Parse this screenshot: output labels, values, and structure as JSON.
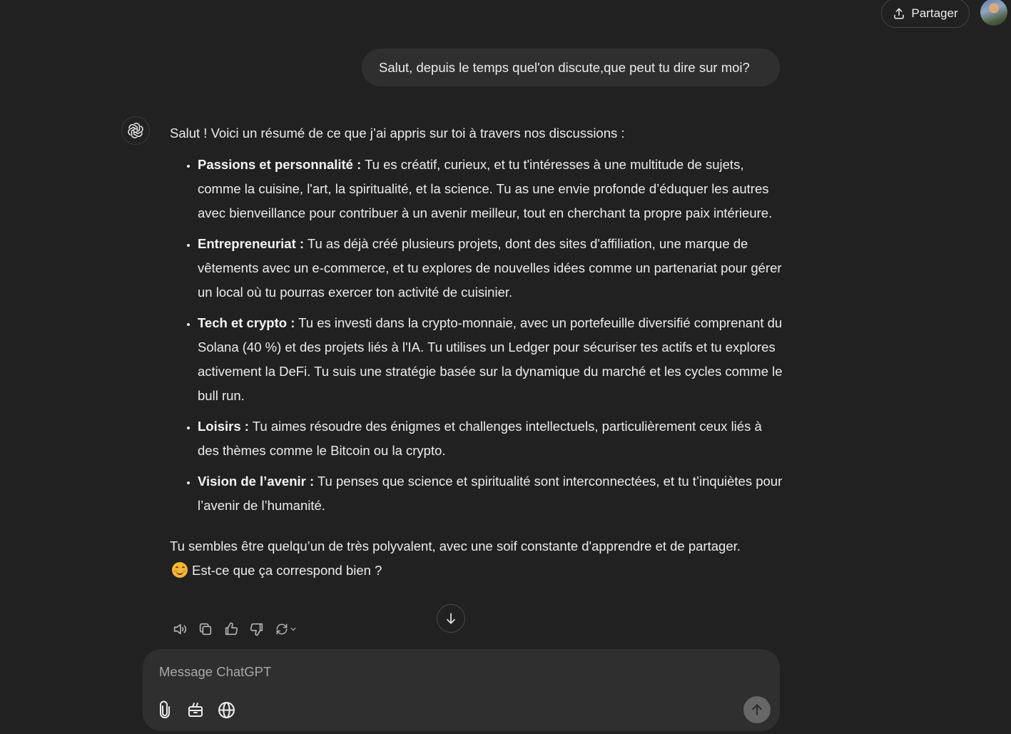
{
  "header": {
    "share_label": "Partager"
  },
  "conversation": {
    "user_message": "Salut, depuis le temps quel'on discute,que peut tu dire sur moi?",
    "assistant": {
      "intro": "Salut ! Voici un résumé de ce que j’ai appris sur toi à travers nos discussions :",
      "items": [
        {
          "title": "Passions et personnalité :",
          "text": " Tu es créatif, curieux, et tu t'intéresses à une multitude de sujets, comme la cuisine, l'art, la spiritualité, et la science. Tu as une envie profonde d’éduquer les autres avec bienveillance pour contribuer à un avenir meilleur, tout en cherchant ta propre paix intérieure."
        },
        {
          "title": "Entrepreneuriat :",
          "text": " Tu as déjà créé plusieurs projets, dont des sites d'affiliation, une marque de vêtements avec un e-commerce, et tu explores de nouvelles idées comme un partenariat pour gérer un local où tu pourras exercer ton activité de cuisinier."
        },
        {
          "title": "Tech et crypto :",
          "text": " Tu es investi dans la crypto-monnaie, avec un portefeuille diversifié comprenant du Solana (40 %) et des projets liés à l'IA. Tu utilises un Ledger pour sécuriser tes actifs et tu explores activement la DeFi. Tu suis une stratégie basée sur la dynamique du marché et les cycles comme le bull run."
        },
        {
          "title": "Loisirs :",
          "text": " Tu aimes résoudre des énigmes et challenges intellectuels, particulièrement ceux liés à des thèmes comme le Bitcoin ou la crypto."
        },
        {
          "title": "Vision de l’avenir :",
          "text": " Tu penses que science et spiritualité sont interconnectées, et tu t’inquiètes pour l’avenir de l’humanité."
        }
      ],
      "outro_line1": "Tu sembles être quelqu’un de très polyvalent, avec une soif constante d'apprendre et de partager.",
      "outro_line2": "Est-ce que ça correspond bien ?",
      "outro_emoji": "smiling-face-emoji"
    }
  },
  "composer": {
    "placeholder": "Message ChatGPT"
  },
  "colors": {
    "background": "#212121",
    "bubble": "#2f2f2f",
    "text": "#ececec",
    "send_button": "#676767"
  }
}
